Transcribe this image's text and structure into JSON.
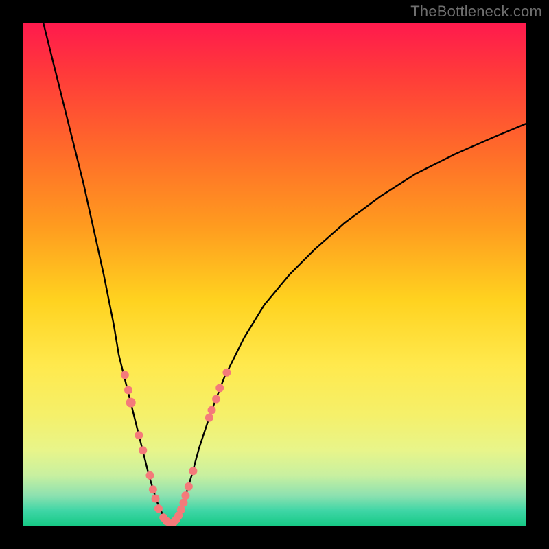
{
  "watermark": "TheBottleneck.com",
  "chart_data": {
    "type": "line",
    "title": "",
    "xlabel": "",
    "ylabel": "",
    "xlim": [
      0,
      100
    ],
    "ylim": [
      0,
      100
    ],
    "series": [
      {
        "name": "left-branch",
        "x": [
          4,
          6,
          8,
          10,
          12,
          14,
          16,
          18,
          19,
          20.5,
          22,
          23.5,
          25,
          26.5,
          28,
          29.2
        ],
        "y": [
          100,
          92,
          84,
          76,
          68,
          59,
          50,
          40,
          34,
          28,
          22,
          16,
          10,
          5,
          1.6,
          0.3
        ]
      },
      {
        "name": "right-branch",
        "x": [
          29.2,
          30.5,
          32,
          33.5,
          35,
          37.5,
          40,
          44,
          48,
          53,
          58,
          64,
          71,
          78,
          86,
          94,
          100
        ],
        "y": [
          0.3,
          1.5,
          5,
          10,
          15.5,
          23,
          29.5,
          37.5,
          44,
          50,
          55,
          60.3,
          65.5,
          70,
          74,
          77.5,
          80
        ]
      }
    ],
    "scatter": {
      "name": "highlight-dots",
      "color": "#f47a7a",
      "points": [
        {
          "x": 20.2,
          "y": 30.0,
          "r": 6
        },
        {
          "x": 20.9,
          "y": 27.0,
          "r": 6
        },
        {
          "x": 21.4,
          "y": 24.5,
          "r": 7
        },
        {
          "x": 23.0,
          "y": 18.0,
          "r": 6
        },
        {
          "x": 23.8,
          "y": 15.0,
          "r": 6
        },
        {
          "x": 25.2,
          "y": 10.0,
          "r": 6
        },
        {
          "x": 25.8,
          "y": 7.2,
          "r": 6
        },
        {
          "x": 26.3,
          "y": 5.4,
          "r": 6
        },
        {
          "x": 26.9,
          "y": 3.4,
          "r": 6
        },
        {
          "x": 27.9,
          "y": 1.6,
          "r": 6
        },
        {
          "x": 28.5,
          "y": 0.9,
          "r": 6
        },
        {
          "x": 29.2,
          "y": 0.4,
          "r": 6
        },
        {
          "x": 29.8,
          "y": 0.5,
          "r": 6
        },
        {
          "x": 30.4,
          "y": 1.2,
          "r": 6
        },
        {
          "x": 30.9,
          "y": 2.0,
          "r": 6
        },
        {
          "x": 31.4,
          "y": 3.2,
          "r": 6
        },
        {
          "x": 31.9,
          "y": 4.6,
          "r": 6
        },
        {
          "x": 32.3,
          "y": 6.0,
          "r": 6
        },
        {
          "x": 32.9,
          "y": 7.8,
          "r": 6
        },
        {
          "x": 33.8,
          "y": 10.9,
          "r": 6
        },
        {
          "x": 37.0,
          "y": 21.5,
          "r": 6
        },
        {
          "x": 37.5,
          "y": 23.0,
          "r": 6
        },
        {
          "x": 38.4,
          "y": 25.2,
          "r": 6
        },
        {
          "x": 39.1,
          "y": 27.4,
          "r": 6
        },
        {
          "x": 40.5,
          "y": 30.5,
          "r": 6
        }
      ]
    }
  }
}
